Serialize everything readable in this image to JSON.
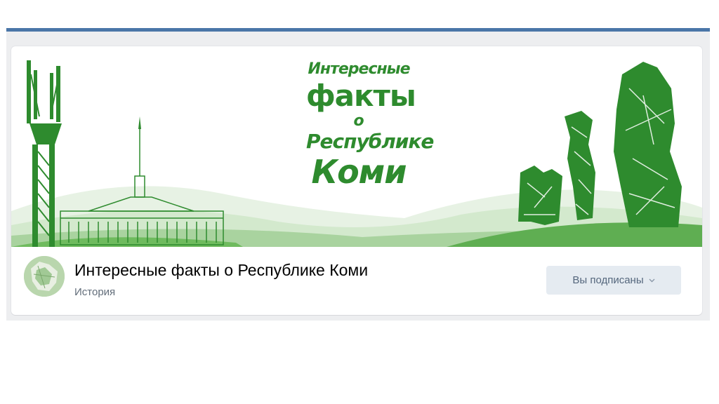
{
  "cover": {
    "title_line1": "Интересные",
    "title_line2": "факты",
    "title_line3": "о",
    "title_line4": "Республике",
    "title_line5": "Коми"
  },
  "group": {
    "name": "Интересные факты о Республике Коми",
    "category": "История"
  },
  "subscribe_button": {
    "label": "Вы подписаны",
    "icon": "chevron-down-icon"
  },
  "colors": {
    "accent_bar": "#4a76a8",
    "cover_green": "#2e8b2e",
    "button_bg": "#e5ebf1",
    "button_text": "#55677d"
  }
}
